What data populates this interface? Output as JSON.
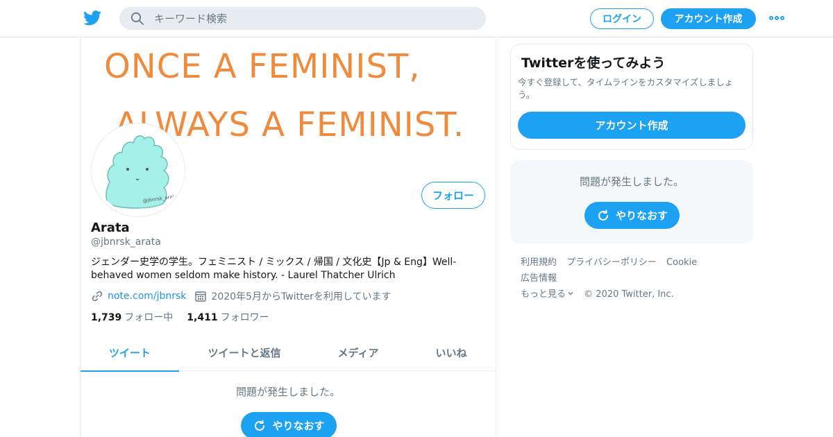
{
  "header": {
    "logo_icon": "twitter-bird-icon",
    "search_placeholder": "キーワード検索",
    "login_label": "ログイン",
    "signup_label": "アカウント作成",
    "more_icon": "more-dots-icon"
  },
  "profile": {
    "banner_line1": "ONCE A FEMINIST,",
    "banner_line2": "ALWAYS A FEMINIST.",
    "follow_label": "フォロー",
    "name": "Arata",
    "handle": "@jbnrsk_arata",
    "bio": "ジェンダー史学の学生。フェミニスト / ミックス / 帰国 / 文化史【Jp & Eng】Well-behaved women seldom make history. - Laurel Thatcher Ulrich",
    "link": "note.com/jbnrsk",
    "joined": "2020年5月からTwitterを利用しています",
    "following_count": "1,739",
    "following_label": "フォロー中",
    "followers_count": "1,411",
    "followers_label": "フォロワー",
    "avatar_watermark": "@jbnrsk_arata"
  },
  "tabs": [
    {
      "label": "ツイート",
      "active": true
    },
    {
      "label": "ツイートと返信",
      "active": false
    },
    {
      "label": "メディア",
      "active": false
    },
    {
      "label": "いいね",
      "active": false
    }
  ],
  "timeline": {
    "error_text": "問題が発生しました。",
    "retry_label": "やりなおす"
  },
  "sidebar": {
    "card_title": "Twitterを使ってみよう",
    "card_desc": "今すぐ登録して、タイムラインをカスタマイズしましょう。",
    "card_button": "アカウント作成",
    "error_text": "問題が発生しました。",
    "retry_label": "やりなおす"
  },
  "footer": {
    "terms": "利用規約",
    "privacy": "プライバシーポリシー",
    "cookie": "Cookie",
    "ads": "広告情報",
    "more": "もっと見る",
    "copyright": "© 2020 Twitter, Inc."
  },
  "colors": {
    "accent": "#1da1f2",
    "banner_text": "#f08a3c",
    "avatar_fill": "#a6f0ea"
  }
}
